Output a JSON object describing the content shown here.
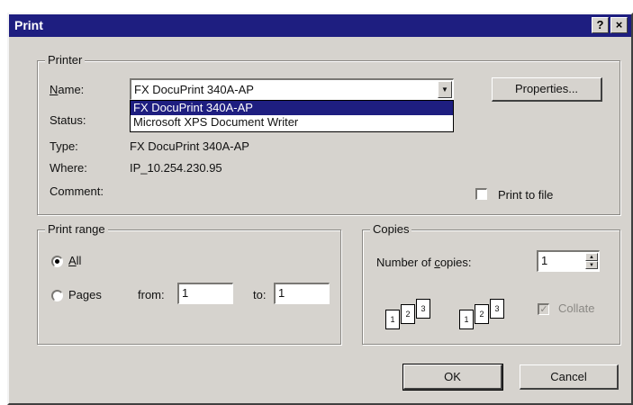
{
  "window": {
    "title": "Print",
    "help_glyph": "?",
    "close_glyph": "×"
  },
  "printer": {
    "group_title": "Printer",
    "name_label": "Name:",
    "name_value": "FX DocuPrint 340A-AP",
    "properties_label": "Properties...",
    "dropdown_options": [
      "FX DocuPrint 340A-AP",
      "Microsoft XPS Document Writer"
    ],
    "status_label": "Status:",
    "type_label": "Type:",
    "type_value": "FX DocuPrint 340A-AP",
    "where_label": "Where:",
    "where_value": "IP_10.254.230.95",
    "comment_label": "Comment:",
    "print_to_file_label": "Print to file",
    "print_to_file_checked": false
  },
  "print_range": {
    "group_title": "Print range",
    "all_label": "All",
    "pages_label": "Pages",
    "from_label": "from:",
    "from_value": "1",
    "to_label": "to:",
    "to_value": "1",
    "selected": "all"
  },
  "copies": {
    "group_title": "Copies",
    "number_label": "Number of copies:",
    "number_value": "1",
    "collate_label": "Collate",
    "collate_checked": true,
    "collate_enabled": false,
    "page_numbers": [
      "1",
      "2",
      "3"
    ]
  },
  "buttons": {
    "ok_label": "OK",
    "cancel_label": "Cancel"
  },
  "colors": {
    "titlebar": "#1e1e80",
    "face": "#d6d3ce",
    "selection": "#1e1e80"
  }
}
